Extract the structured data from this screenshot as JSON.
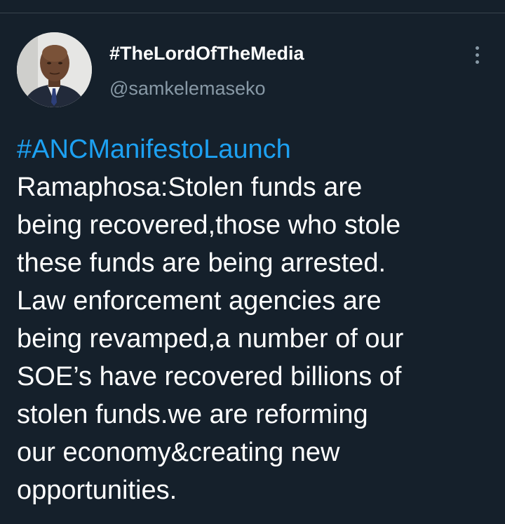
{
  "author": {
    "display_name": "#TheLordOfTheMedia",
    "handle": "@samkelemaseko"
  },
  "tweet": {
    "hashtag": "#ANCManifestoLaunch",
    "lines": [
      "Ramaphosa:Stolen funds are",
      "being recovered,those who stole",
      "these funds are being arrested.",
      "Law enforcement agencies are",
      "being revamped,a number of our",
      "SOE’s have recovered billions of",
      "stolen funds.we are reforming",
      "our economy&creating new",
      "opportunities."
    ]
  },
  "icons": {
    "more": "more-vertical-icon"
  },
  "colors": {
    "background": "#15202b",
    "link": "#1da1f2",
    "secondary_text": "#8899a6",
    "primary_text": "#ffffff"
  }
}
